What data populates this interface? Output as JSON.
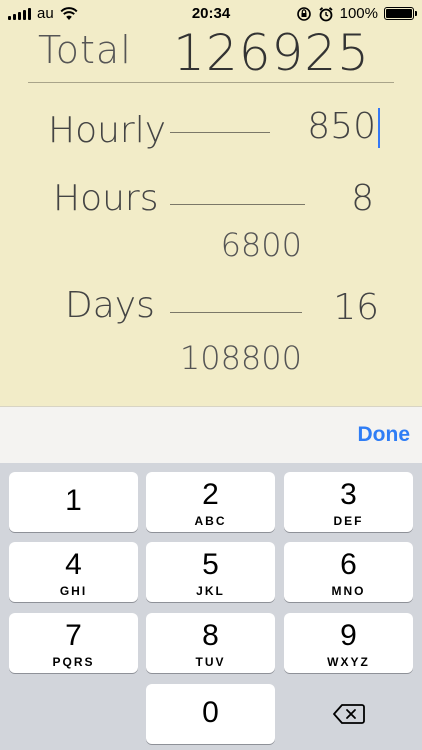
{
  "status_bar": {
    "carrier": "au",
    "time": "20:34",
    "battery_percent": "100%",
    "battery_level": 1.0,
    "icons": [
      "signal-bars-icon",
      "wifi-icon",
      "orientation-lock-icon",
      "alarm-icon",
      "battery-icon"
    ]
  },
  "calculator": {
    "total_label": "Total",
    "total_value": "126925",
    "rows": {
      "hourly": {
        "label": "Hourly",
        "value": "850"
      },
      "hours": {
        "label": "Hours",
        "value": "8",
        "subtotal": "6800"
      },
      "days": {
        "label": "Days",
        "value": "16",
        "subtotal": "108800"
      }
    }
  },
  "keyboard": {
    "done_label": "Done",
    "keys": [
      {
        "digit": "1",
        "letters": ""
      },
      {
        "digit": "2",
        "letters": "ABC"
      },
      {
        "digit": "3",
        "letters": "DEF"
      },
      {
        "digit": "4",
        "letters": "GHI"
      },
      {
        "digit": "5",
        "letters": "JKL"
      },
      {
        "digit": "6",
        "letters": "MNO"
      },
      {
        "digit": "7",
        "letters": "PQRS"
      },
      {
        "digit": "8",
        "letters": "TUV"
      },
      {
        "digit": "9",
        "letters": "WXYZ"
      },
      {
        "digit": "0",
        "letters": ""
      }
    ],
    "delete_icon": "backspace-icon"
  }
}
